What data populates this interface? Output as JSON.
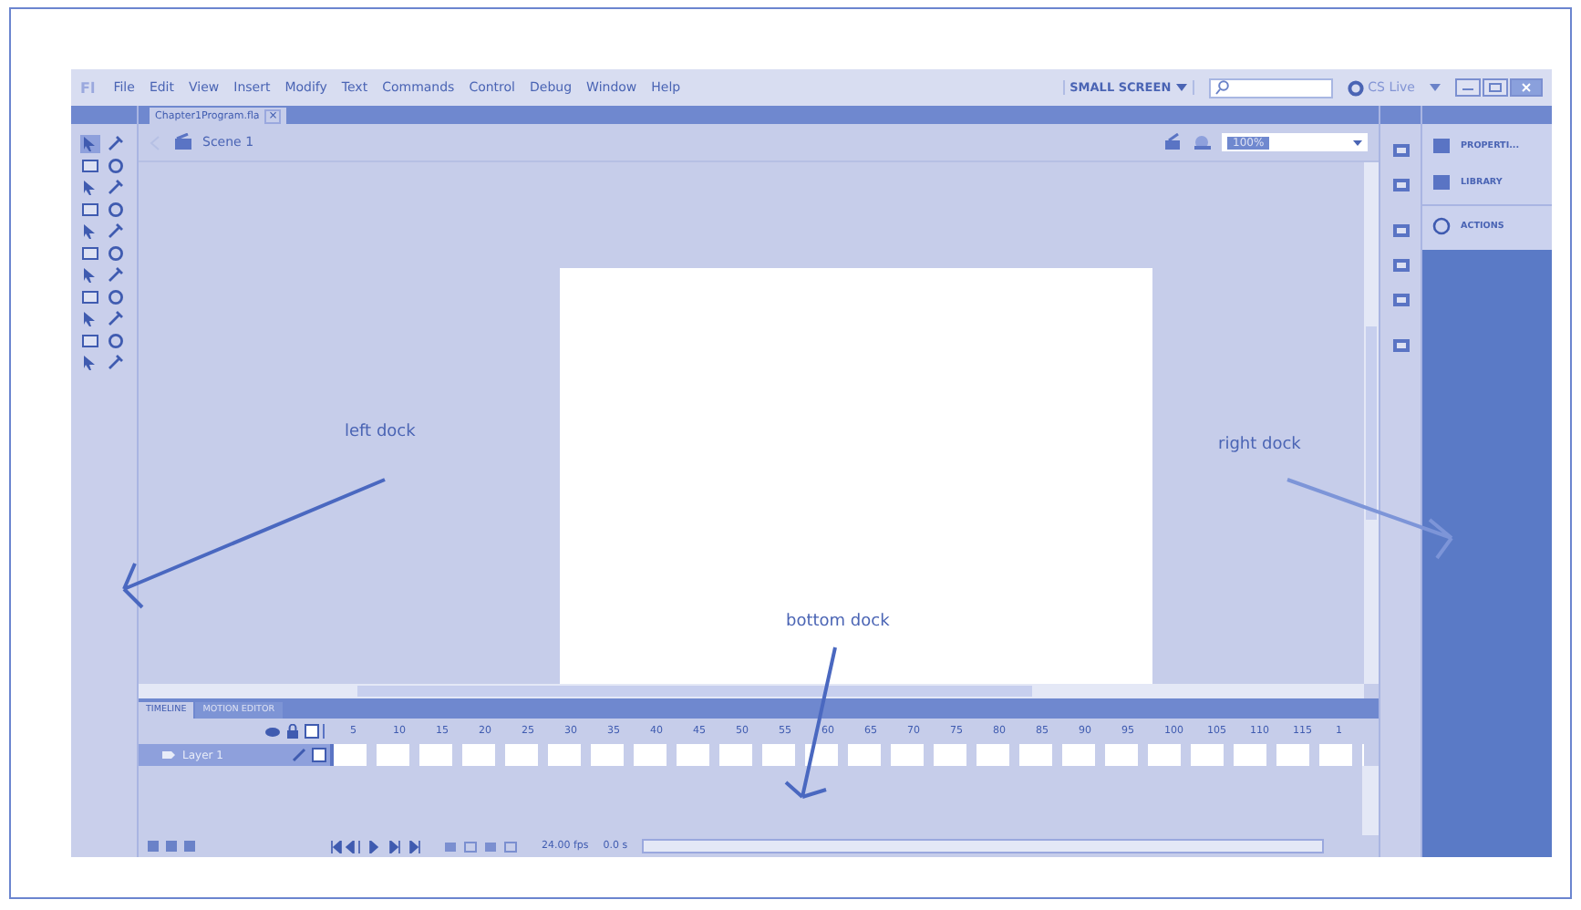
{
  "menu_bar": {
    "logo": "Fl",
    "items": [
      "File",
      "Edit",
      "View",
      "Insert",
      "Modify",
      "Text",
      "Commands",
      "Control",
      "Debug",
      "Window",
      "Help"
    ],
    "workspace": "SMALL SCREEN",
    "cs_live": "CS Live"
  },
  "document_tab": {
    "title": "Chapter1Program.fla",
    "close": "×"
  },
  "edit_bar": {
    "scene": "Scene 1",
    "zoom": "100%"
  },
  "right_panel": {
    "items": [
      {
        "label": "PROPERTI..."
      },
      {
        "label": "LIBRARY"
      },
      {
        "label": "ACTIONS"
      }
    ]
  },
  "timeline": {
    "tabs": [
      {
        "label": "TIMELINE",
        "selected": true
      },
      {
        "label": "MOTION EDITOR",
        "selected": false
      }
    ],
    "frame_numbers": [
      "5",
      "10",
      "15",
      "20",
      "25",
      "30",
      "35",
      "40",
      "45",
      "50",
      "55",
      "60",
      "65",
      "70",
      "75",
      "80",
      "85",
      "90",
      "95",
      "100",
      "105",
      "110",
      "115",
      "1"
    ],
    "layers": [
      {
        "name": "Layer 1",
        "selected": true
      }
    ],
    "fps": "24.00 fps",
    "time": "0.0 s"
  },
  "annotations": [
    {
      "label": "left dock"
    },
    {
      "label": "right dock"
    },
    {
      "label": "bottom dock"
    }
  ]
}
